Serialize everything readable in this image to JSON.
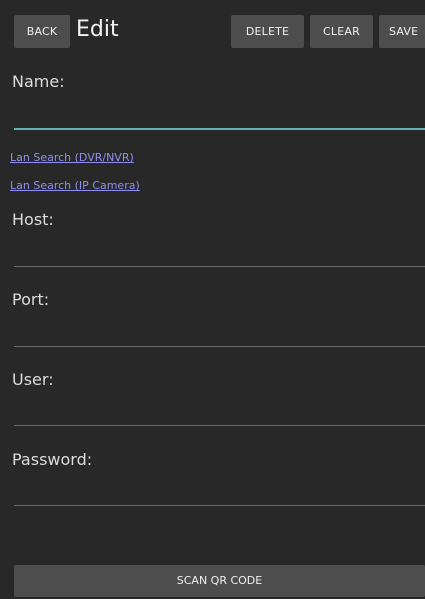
{
  "toolbar": {
    "back_label": "BACK",
    "title": "Edit",
    "delete_label": "DELETE",
    "clear_label": "CLEAR",
    "save_label": "SAVE"
  },
  "form": {
    "name_label": "Name:",
    "name_value": "",
    "lan_search_dvr": "Lan Search (DVR/NVR)",
    "lan_search_ip": "Lan Search (IP Camera)",
    "host_label": "Host:",
    "host_value": "",
    "port_label": "Port:",
    "port_value": "",
    "user_label": "User:",
    "user_value": "",
    "password_label": "Password:",
    "password_value": "",
    "scan_label": "SCAN QR CODE"
  },
  "colors": {
    "background": "#282828",
    "button": "#4d4d4d",
    "focus_accent": "#62b2b5",
    "link": "#8f8ff0"
  }
}
